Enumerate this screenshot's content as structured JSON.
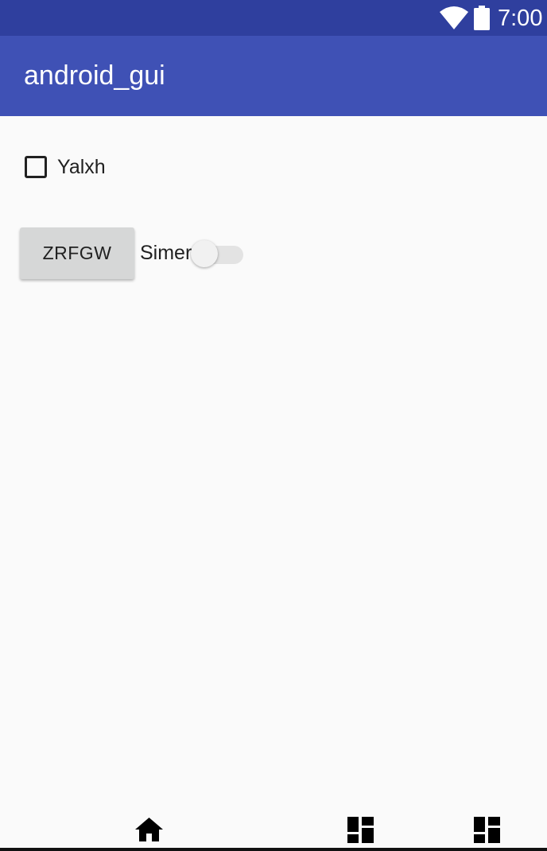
{
  "status_bar": {
    "time": "7:00",
    "wifi_icon": "wifi-icon",
    "battery_icon": "battery-icon"
  },
  "app_bar": {
    "title": "android_gui"
  },
  "content": {
    "checkbox": {
      "label": "Yalxh",
      "checked": false
    },
    "button": {
      "label": "ZRFGW"
    },
    "switch": {
      "label": "Simer",
      "on": false
    }
  },
  "nav_bar": {
    "icons": [
      "home-icon",
      "dashboard-icon",
      "dashboard-icon"
    ]
  },
  "colors": {
    "status_bar": "#2f3f9e",
    "app_bar": "#3f51b5",
    "background": "#fafafa",
    "button": "#d6d7d7"
  }
}
